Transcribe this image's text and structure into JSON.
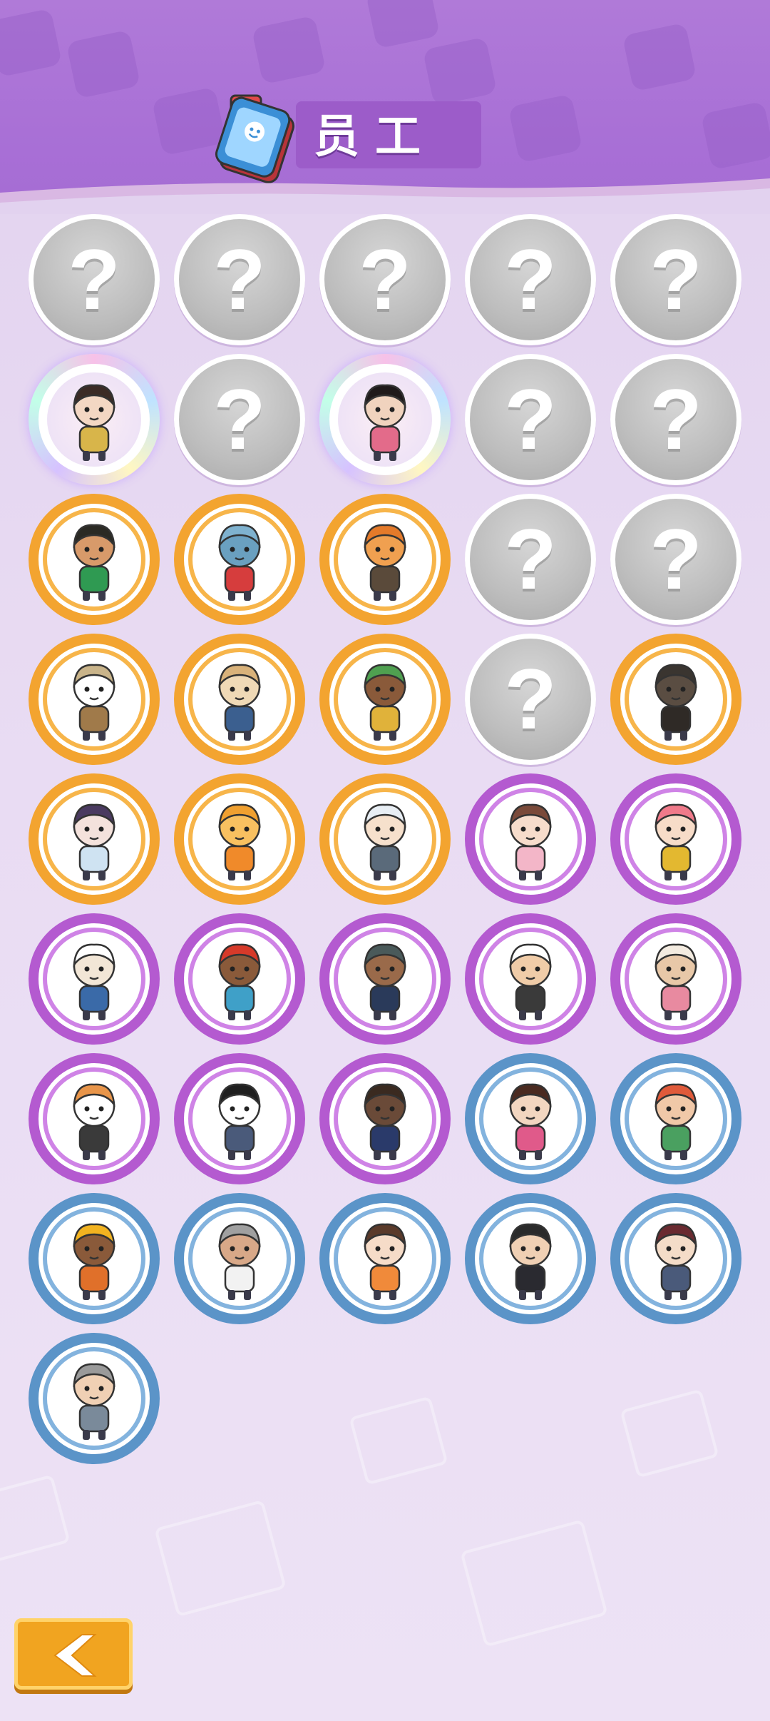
{
  "header": {
    "title": "员工",
    "icon": "staff-card-icon"
  },
  "grid": {
    "columns": 5,
    "slots": [
      {
        "state": "locked",
        "label": "?"
      },
      {
        "state": "locked",
        "label": "?"
      },
      {
        "state": "locked",
        "label": "?"
      },
      {
        "state": "locked",
        "label": "?"
      },
      {
        "state": "locked",
        "label": "?"
      },
      {
        "state": "holo",
        "icon": "cat-eared-adventurer-avatar",
        "hair": "#3b2b25",
        "skin": "#f3d7c3",
        "outfit": "#d8b54a"
      },
      {
        "state": "locked",
        "label": "?"
      },
      {
        "state": "holo",
        "icon": "chef-lady-avatar",
        "hair": "#1f1a1a",
        "skin": "#f0d3be",
        "outfit": "#e36b8a"
      },
      {
        "state": "locked",
        "label": "?"
      },
      {
        "state": "locked",
        "label": "?"
      },
      {
        "state": "orange",
        "icon": "elf-on-cloud-avatar",
        "hair": "#2b2a24",
        "skin": "#d89a6a",
        "outfit": "#2f9a52"
      },
      {
        "state": "orange",
        "icon": "fish-astronaut-avatar",
        "hair": "#7fb2cf",
        "skin": "#6aa0c0",
        "outfit": "#d63d3d"
      },
      {
        "state": "orange",
        "icon": "cooking-robot-avatar",
        "hair": "#e47a2a",
        "skin": "#f0a050",
        "outfit": "#5a4a3a"
      },
      {
        "state": "locked",
        "label": "?"
      },
      {
        "state": "locked",
        "label": "?"
      },
      {
        "state": "orange",
        "icon": "panda-explorer-avatar",
        "hair": "#c9b48a",
        "skin": "#ffffff",
        "outfit": "#a07a4a"
      },
      {
        "state": "orange",
        "icon": "wolf-businessman-avatar",
        "hair": "#d9b27a",
        "skin": "#efd9b6",
        "outfit": "#3b5f8f"
      },
      {
        "state": "orange",
        "icon": "green-haired-fisher-avatar",
        "hair": "#4fa050",
        "skin": "#8a5a3a",
        "outfit": "#e0b23a"
      },
      {
        "state": "locked",
        "label": "?"
      },
      {
        "state": "orange",
        "icon": "bronze-statue-avatar",
        "hair": "#3a3530",
        "skin": "#5a4d42",
        "outfit": "#2f2a26"
      },
      {
        "state": "orange",
        "icon": "umbrella-lady-avatar",
        "hair": "#4a3a60",
        "skin": "#f4e2dc",
        "outfit": "#cfe3f2"
      },
      {
        "state": "orange",
        "icon": "orange-robot-avatar",
        "hair": "#f0a030",
        "skin": "#f8c060",
        "outfit": "#f08a2a"
      },
      {
        "state": "orange",
        "icon": "white-haired-boy-avatar",
        "hair": "#e8eef4",
        "skin": "#f6e0cc",
        "outfit": "#5a6a7a"
      },
      {
        "state": "purple",
        "icon": "glasses-girl-avatar",
        "hair": "#7a4a3a",
        "skin": "#f6dccb",
        "outfit": "#f3b6c8"
      },
      {
        "state": "purple",
        "icon": "pink-haired-girl-avatar",
        "hair": "#f07a8a",
        "skin": "#f7dcc8",
        "outfit": "#e3b830"
      },
      {
        "state": "purple",
        "icon": "sailor-cat-avatar",
        "hair": "#ffffff",
        "skin": "#f2e6d6",
        "outfit": "#3a6aa8"
      },
      {
        "state": "purple",
        "icon": "bandana-boy-avatar",
        "hair": "#d63a2a",
        "skin": "#8a5a3a",
        "outfit": "#3fa0c8"
      },
      {
        "state": "purple",
        "icon": "backpacker-avatar",
        "hair": "#4a5a5a",
        "skin": "#9a6a4a",
        "outfit": "#2a3a5a"
      },
      {
        "state": "purple",
        "icon": "bald-chef-avatar",
        "hair": "#ffffff",
        "skin": "#f0cca8",
        "outfit": "#3a3a3a"
      },
      {
        "state": "purple",
        "icon": "sheep-gardener-avatar",
        "hair": "#f3ebe0",
        "skin": "#e8c8a8",
        "outfit": "#e88aa0"
      },
      {
        "state": "purple",
        "icon": "corgi-avatar",
        "hair": "#e8954a",
        "skin": "#ffffff",
        "outfit": "#3a3a3a"
      },
      {
        "state": "purple",
        "icon": "panda-avatar",
        "hair": "#1f1f1f",
        "skin": "#ffffff",
        "outfit": "#4a5a7a"
      },
      {
        "state": "purple",
        "icon": "walrus-detective-avatar",
        "hair": "#3a2a20",
        "skin": "#6a4a38",
        "outfit": "#2a3a6a"
      },
      {
        "state": "blue",
        "icon": "smiling-woman-avatar",
        "hair": "#4a2a20",
        "skin": "#f2d6c0",
        "outfit": "#e05a8a"
      },
      {
        "state": "blue",
        "icon": "red-haired-boy-avatar",
        "hair": "#e05a3a",
        "skin": "#f0c8a8",
        "outfit": "#4aa060"
      },
      {
        "state": "blue",
        "icon": "construction-worker-avatar",
        "hair": "#f2b320",
        "skin": "#8a5a3a",
        "outfit": "#e0702a"
      },
      {
        "state": "blue",
        "icon": "grumpy-old-man-avatar",
        "hair": "#a0a0a0",
        "skin": "#d8a888",
        "outfit": "#f2f2f2"
      },
      {
        "state": "blue",
        "icon": "blushing-lady-avatar",
        "hair": "#5a3a2a",
        "skin": "#f6dcc8",
        "outfit": "#f08a3a"
      },
      {
        "state": "blue",
        "icon": "beanie-man-avatar",
        "hair": "#2a2a2a",
        "skin": "#f0d0b4",
        "outfit": "#2a2a30"
      },
      {
        "state": "blue",
        "icon": "schoolgirl-avatar",
        "hair": "#6a2a30",
        "skin": "#f4dcc8",
        "outfit": "#4a5a7a"
      },
      {
        "state": "blue",
        "icon": "gray-haired-worker-avatar",
        "hair": "#9a9a9a",
        "skin": "#f0d0b4",
        "outfit": "#7a8a9a"
      }
    ]
  },
  "footer": {
    "back_icon": "back-arrow-icon"
  }
}
